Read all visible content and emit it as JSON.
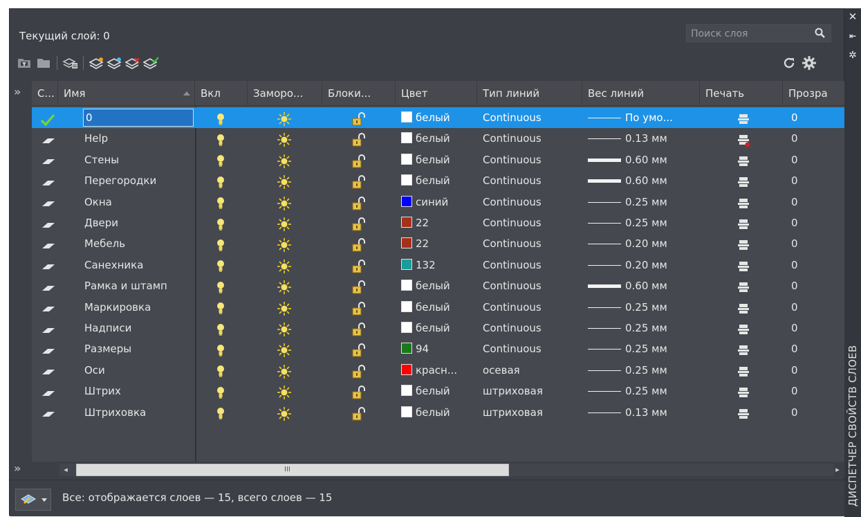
{
  "header": {
    "current_layer": "Текущий слой: 0",
    "search_placeholder": "Поиск слоя"
  },
  "side_panel": {
    "title": "ДИСПЕТЧЕР СВОЙСТВ СЛОЕВ"
  },
  "columns": [
    "С...",
    "Имя",
    "Вкл",
    "Заморо...",
    "Блоки...",
    "Цвет",
    "Тип линий",
    "Вес линий",
    "Печать",
    "Прозра"
  ],
  "layers": [
    {
      "name": "0",
      "color_name": "белый",
      "color_hex": "#ffffff",
      "linetype": "Continuous",
      "lineweight": "По умо...",
      "lw_thickness": 1,
      "transparency": "0",
      "current": true,
      "plot_disabled": false
    },
    {
      "name": "Help",
      "color_name": "белый",
      "color_hex": "#ffffff",
      "linetype": "Continuous",
      "lineweight": "0.13 мм",
      "lw_thickness": 1,
      "transparency": "0",
      "current": false,
      "plot_disabled": true
    },
    {
      "name": "Стены",
      "color_name": "белый",
      "color_hex": "#ffffff",
      "linetype": "Continuous",
      "lineweight": "0.60 мм",
      "lw_thickness": 5,
      "transparency": "0",
      "current": false,
      "plot_disabled": false
    },
    {
      "name": "Перегородки",
      "color_name": "белый",
      "color_hex": "#ffffff",
      "linetype": "Continuous",
      "lineweight": "0.60 мм",
      "lw_thickness": 5,
      "transparency": "0",
      "current": false,
      "plot_disabled": false
    },
    {
      "name": "Окна",
      "color_name": "синий",
      "color_hex": "#0000ff",
      "linetype": "Continuous",
      "lineweight": "0.25 мм",
      "lw_thickness": 1,
      "transparency": "0",
      "current": false,
      "plot_disabled": false
    },
    {
      "name": "Двери",
      "color_name": "22",
      "color_hex": "#a5311a",
      "linetype": "Continuous",
      "lineweight": "0.25 мм",
      "lw_thickness": 1,
      "transparency": "0",
      "current": false,
      "plot_disabled": false
    },
    {
      "name": "Мебель",
      "color_name": "22",
      "color_hex": "#a5311a",
      "linetype": "Continuous",
      "lineweight": "0.20 мм",
      "lw_thickness": 1,
      "transparency": "0",
      "current": false,
      "plot_disabled": false
    },
    {
      "name": "Санехника",
      "color_name": "132",
      "color_hex": "#1a9c98",
      "linetype": "Continuous",
      "lineweight": "0.20 мм",
      "lw_thickness": 1,
      "transparency": "0",
      "current": false,
      "plot_disabled": false
    },
    {
      "name": "Рамка и штамп",
      "color_name": "белый",
      "color_hex": "#ffffff",
      "linetype": "Continuous",
      "lineweight": "0.60 мм",
      "lw_thickness": 5,
      "transparency": "0",
      "current": false,
      "plot_disabled": false
    },
    {
      "name": "Маркировка",
      "color_name": "белый",
      "color_hex": "#ffffff",
      "linetype": "Continuous",
      "lineweight": "0.25 мм",
      "lw_thickness": 1,
      "transparency": "0",
      "current": false,
      "plot_disabled": false
    },
    {
      "name": "Надписи",
      "color_name": "белый",
      "color_hex": "#ffffff",
      "linetype": "Continuous",
      "lineweight": "0.25 мм",
      "lw_thickness": 1,
      "transparency": "0",
      "current": false,
      "plot_disabled": false
    },
    {
      "name": "Размеры",
      "color_name": "94",
      "color_hex": "#1a7a1a",
      "linetype": "Continuous",
      "lineweight": "0.25 мм",
      "lw_thickness": 1,
      "transparency": "0",
      "current": false,
      "plot_disabled": false
    },
    {
      "name": "Оси",
      "color_name": "красн...",
      "color_hex": "#ff0000",
      "linetype": "осевая",
      "lineweight": "0.25 мм",
      "lw_thickness": 1,
      "transparency": "0",
      "current": false,
      "plot_disabled": false
    },
    {
      "name": "Штрих",
      "color_name": "белый",
      "color_hex": "#ffffff",
      "linetype": "штриховая",
      "lineweight": "0.25 мм",
      "lw_thickness": 1,
      "transparency": "0",
      "current": false,
      "plot_disabled": false
    },
    {
      "name": "Штриховка",
      "color_name": "белый",
      "color_hex": "#ffffff",
      "linetype": "штриховая",
      "lineweight": "0.13 мм",
      "lw_thickness": 1,
      "transparency": "0",
      "current": false,
      "plot_disabled": false
    }
  ],
  "scrollbar": {
    "grip": "III"
  },
  "status": {
    "text": "Все: отображается слоев — 15, всего слоев — 15"
  },
  "colors": {
    "selection": "#1e92e6",
    "panel_bg": "#3c3f46",
    "grid_bg": "#45484e"
  },
  "icons": {
    "strip": [
      "close-icon",
      "pin-icon",
      "properties-icon"
    ],
    "toolbar": [
      "new-property-filter-icon",
      "new-group-filter-icon",
      "layer-states-manager-icon",
      "new-layer-icon",
      "new-layer-vp-frozen-icon",
      "delete-layer-icon",
      "set-current-icon"
    ],
    "row_status_current": "checkmark-icon",
    "row_status": "layer-icon",
    "on": "lightbulb-icon",
    "freeze": "sun-icon",
    "lock": "unlock-icon",
    "plot": "printer-icon"
  }
}
